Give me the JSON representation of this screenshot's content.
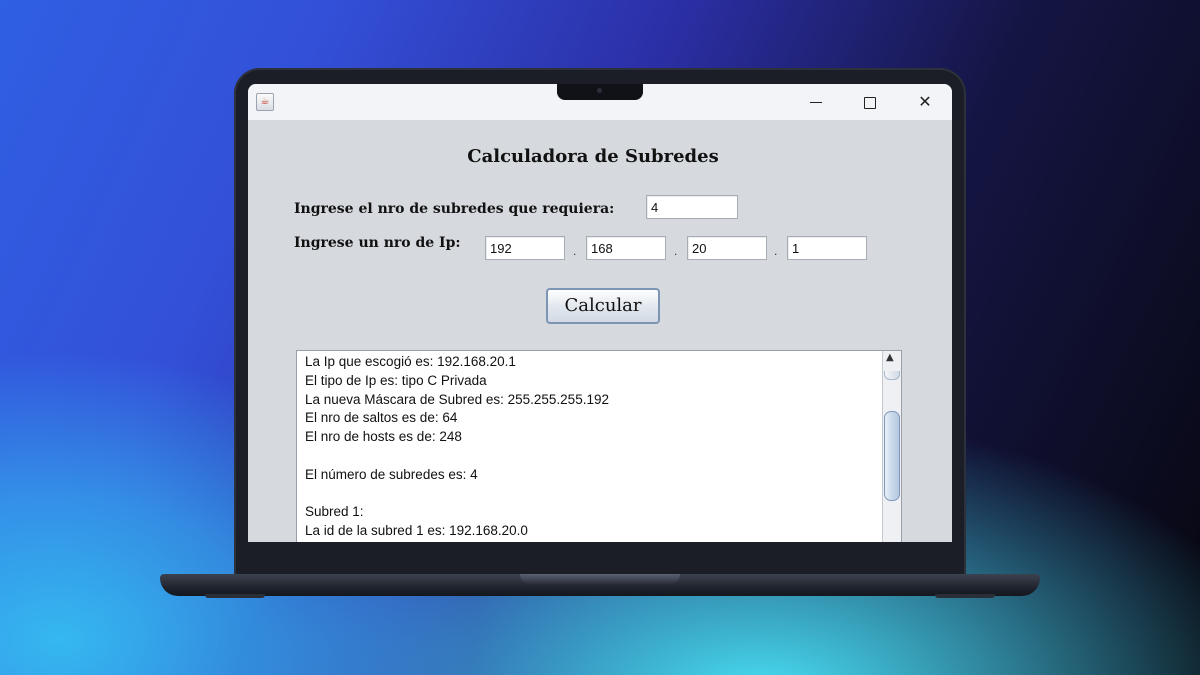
{
  "window": {
    "title_icon": "java-cup-icon",
    "minimize_icon": "minimize-icon",
    "maximize_icon": "maximize-icon",
    "close_icon": "close-icon"
  },
  "form": {
    "title": "Calculadora de Subredes",
    "subnets_label": "Ingrese el nro de subredes que requiera:",
    "subnets_value": "4",
    "ip_label": "Ingrese un nro de Ip:",
    "ip_octets": [
      "192",
      "168",
      "20",
      "1"
    ],
    "separator": ".",
    "calculate_label": "Calcular"
  },
  "output": {
    "lines": [
      "La Ip que escogió es: 192.168.20.1",
      "El tipo de Ip es: tipo C Privada",
      "La nueva Máscara de Subred es: 255.255.255.192",
      "El nro de saltos es de: 64",
      "El nro de hosts es de: 248",
      "",
      "El número de subredes es: 4",
      "",
      "Subred 1:",
      "La id de la subred 1 es: 192.168.20.0"
    ]
  }
}
